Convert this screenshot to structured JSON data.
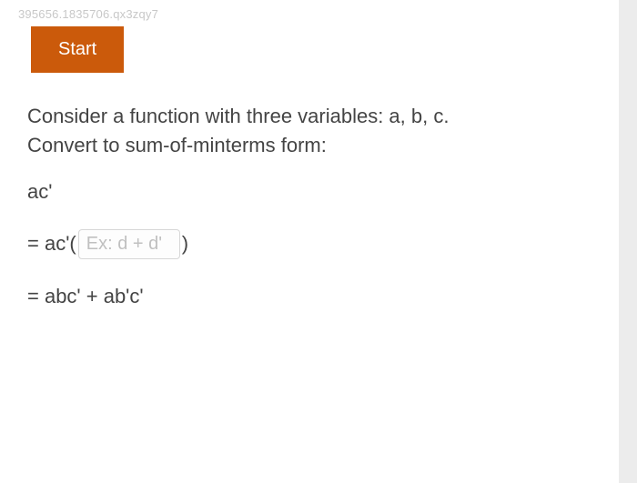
{
  "watermark": "395656.1835706.qx3zqy7",
  "start_label": "Start",
  "prompt": {
    "line1": "Consider a function with three variables: a, b, c.",
    "line2": "Convert to sum-of-minterms form:"
  },
  "expression": {
    "given": "ac'",
    "step1_prefix": "= ac'(",
    "step1_suffix": ")",
    "input_placeholder": "Ex: d + d'",
    "input_value": "",
    "step2": "= abc' + ab'c'"
  }
}
